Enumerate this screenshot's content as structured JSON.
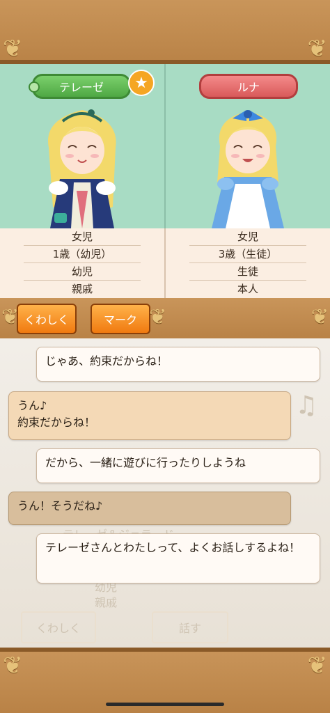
{
  "characters": [
    {
      "name": "テレーゼ",
      "info": [
        "女児",
        "1歳（幼児）",
        "幼児",
        "親戚"
      ],
      "badge": "★"
    },
    {
      "name": "ルナ",
      "info": [
        "女児",
        "3歳（生徒）",
        "生徒",
        "本人"
      ]
    }
  ],
  "buttons": {
    "details": "くわしく",
    "mark": "マーク"
  },
  "chat": [
    {
      "side": "right",
      "text": "じゃあ、約束だからね！"
    },
    {
      "side": "left",
      "text": "うん♪\n約束だからね！"
    },
    {
      "side": "right",
      "text": "だから、一緒に遊びに行ったりしようね"
    },
    {
      "side": "left",
      "text": "うん！そうだね♪"
    },
    {
      "side": "right",
      "text": "テレーゼさんとわたしって、よくお話しするよね！"
    }
  ],
  "background": {
    "name_line": "テレーゼ＆ジェラード",
    "rows": [
      "幼児",
      "親戚"
    ],
    "buttons": [
      "くわしく",
      "話す"
    ]
  },
  "colors": {
    "accent": "#f07a10",
    "tag_green": "#4fa844",
    "tag_red": "#d95a5a",
    "panel": "#a8dcc4"
  }
}
